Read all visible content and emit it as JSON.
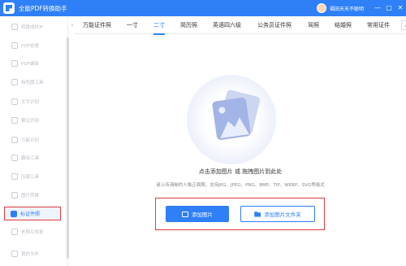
{
  "app": {
    "title": "全能PDF转换助手",
    "user_name": "福田天天不聪明",
    "window_controls": [
      "—",
      "□",
      "✕"
    ]
  },
  "sidebar": {
    "items": [
      {
        "label": "转换成PDF",
        "icon": "file-convert-icon"
      },
      {
        "label": "PDF处理",
        "icon": "pdf-process-icon"
      },
      {
        "label": "PDF编辑",
        "icon": "pdf-edit-icon"
      },
      {
        "label": "特色图工具",
        "icon": "image-tool-icon"
      },
      {
        "label": "文字识别",
        "icon": "text-ocr-icon"
      },
      {
        "label": "票证识别",
        "icon": "ticket-ocr-icon"
      },
      {
        "label": "万能识别",
        "icon": "universal-ocr-icon"
      },
      {
        "label": "翻译工具",
        "icon": "translate-icon"
      },
      {
        "label": "压缩工具",
        "icon": "compress-icon"
      },
      {
        "label": "图片转换",
        "icon": "image-convert-icon"
      },
      {
        "label": "标证件照",
        "icon": "id-photo-icon",
        "active": true
      },
      {
        "label": "老照片修复",
        "icon": "photo-repair-icon"
      },
      {
        "label": "我的文件",
        "icon": "my-files-icon"
      }
    ]
  },
  "tabs": {
    "items": [
      "万能证件照",
      "一寸",
      "二寸",
      "简历照",
      "英语四六级",
      "公务员证件照",
      "驾照",
      "结婚照",
      "常用证件"
    ],
    "active_index": 2
  },
  "upload": {
    "main_hint": "点击添加图片 或 拖拽图片到此处",
    "sub_hint": "请上传清晰的人像正面照，支持JPG、JPEG、PNG、BMP、TIF、WEBP、SVG等格式",
    "add_image_label": "添加图片",
    "add_folder_label": "添加图片文件夹"
  },
  "colors": {
    "accent": "#2f7ff7",
    "highlight_box": "#e23b3b"
  }
}
